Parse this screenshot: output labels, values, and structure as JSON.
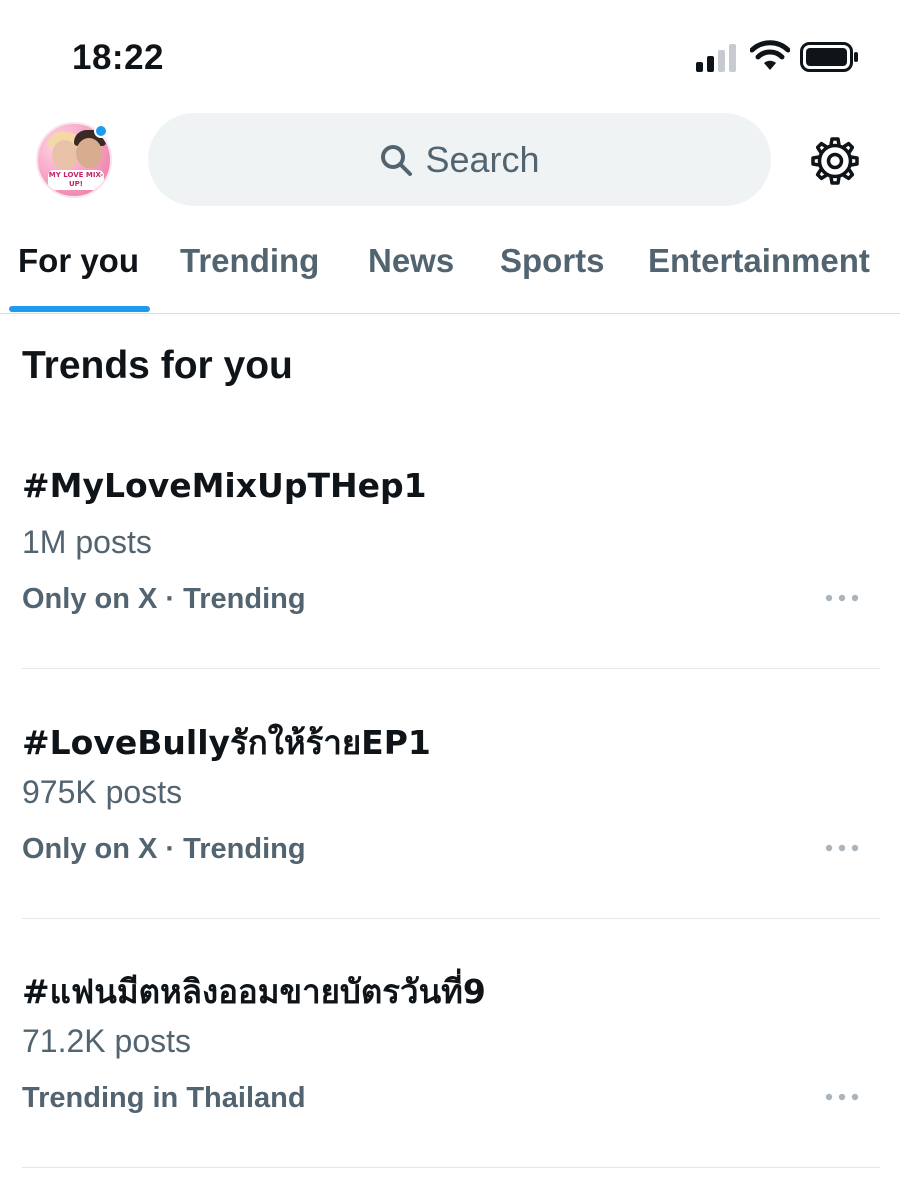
{
  "status_bar": {
    "time": "18:22",
    "icons": [
      "signal-icon",
      "wifi-icon",
      "battery-icon"
    ]
  },
  "header": {
    "avatar_label": "MY LOVE MIX-UP!",
    "search_placeholder": "Search",
    "icons": [
      "search-icon",
      "gear-icon"
    ]
  },
  "tabs": [
    {
      "label": "For you",
      "active": true
    },
    {
      "label": "Trending",
      "active": false
    },
    {
      "label": "News",
      "active": false
    },
    {
      "label": "Sports",
      "active": false
    },
    {
      "label": "Entertainment",
      "active": false
    }
  ],
  "section": {
    "title": "Trends for you"
  },
  "trends": [
    {
      "name": "#MyLoveMixUpTHep1",
      "posts": "1M posts",
      "meta": "Only on X · Trending"
    },
    {
      "name": "#LoveBullyรักให้ร้ายEP1",
      "posts": "975K posts",
      "meta": "Only on X · Trending"
    },
    {
      "name": "#แฟนมีตหลิงออมขายบัตรวันที่9",
      "posts": "71.2K posts",
      "meta": "Trending in Thailand"
    }
  ],
  "colors": {
    "accent": "#1d9bf0",
    "text_primary": "#0f1419",
    "text_secondary": "#536471",
    "search_bg": "#eff3f4"
  }
}
